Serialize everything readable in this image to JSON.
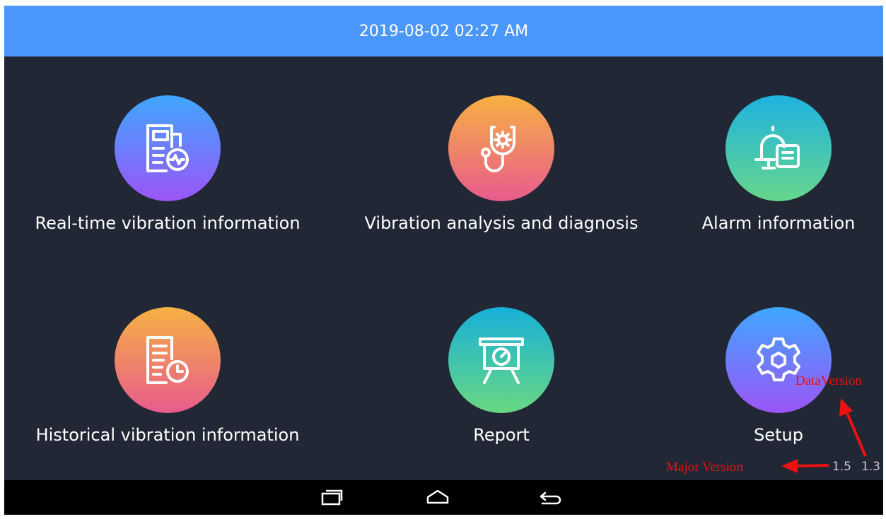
{
  "status_bar": {
    "datetime": "2019-08-02 02:27 AM"
  },
  "menu": {
    "items": [
      {
        "label": "Real-time vibration information",
        "icon": "document-pulse-icon"
      },
      {
        "label": "Vibration analysis and diagnosis",
        "icon": "stethoscope-gear-icon"
      },
      {
        "label": "Alarm information",
        "icon": "bell-list-icon"
      },
      {
        "label": "Historical vibration information",
        "icon": "document-clock-icon"
      },
      {
        "label": "Report",
        "icon": "presentation-gauge-icon"
      },
      {
        "label": "Setup",
        "icon": "gear-hexagon-icon"
      }
    ]
  },
  "versions": {
    "major": "1.5",
    "data": "1.3"
  },
  "annotations": {
    "major_version": "Major Version",
    "data_version": "DataVersion"
  },
  "nav": {
    "icons": [
      "recent-apps-icon",
      "home-icon",
      "back-icon"
    ]
  },
  "colors": {
    "top_bar": "#4c97fb",
    "background": "#212734",
    "annotation": "#ee1111"
  }
}
